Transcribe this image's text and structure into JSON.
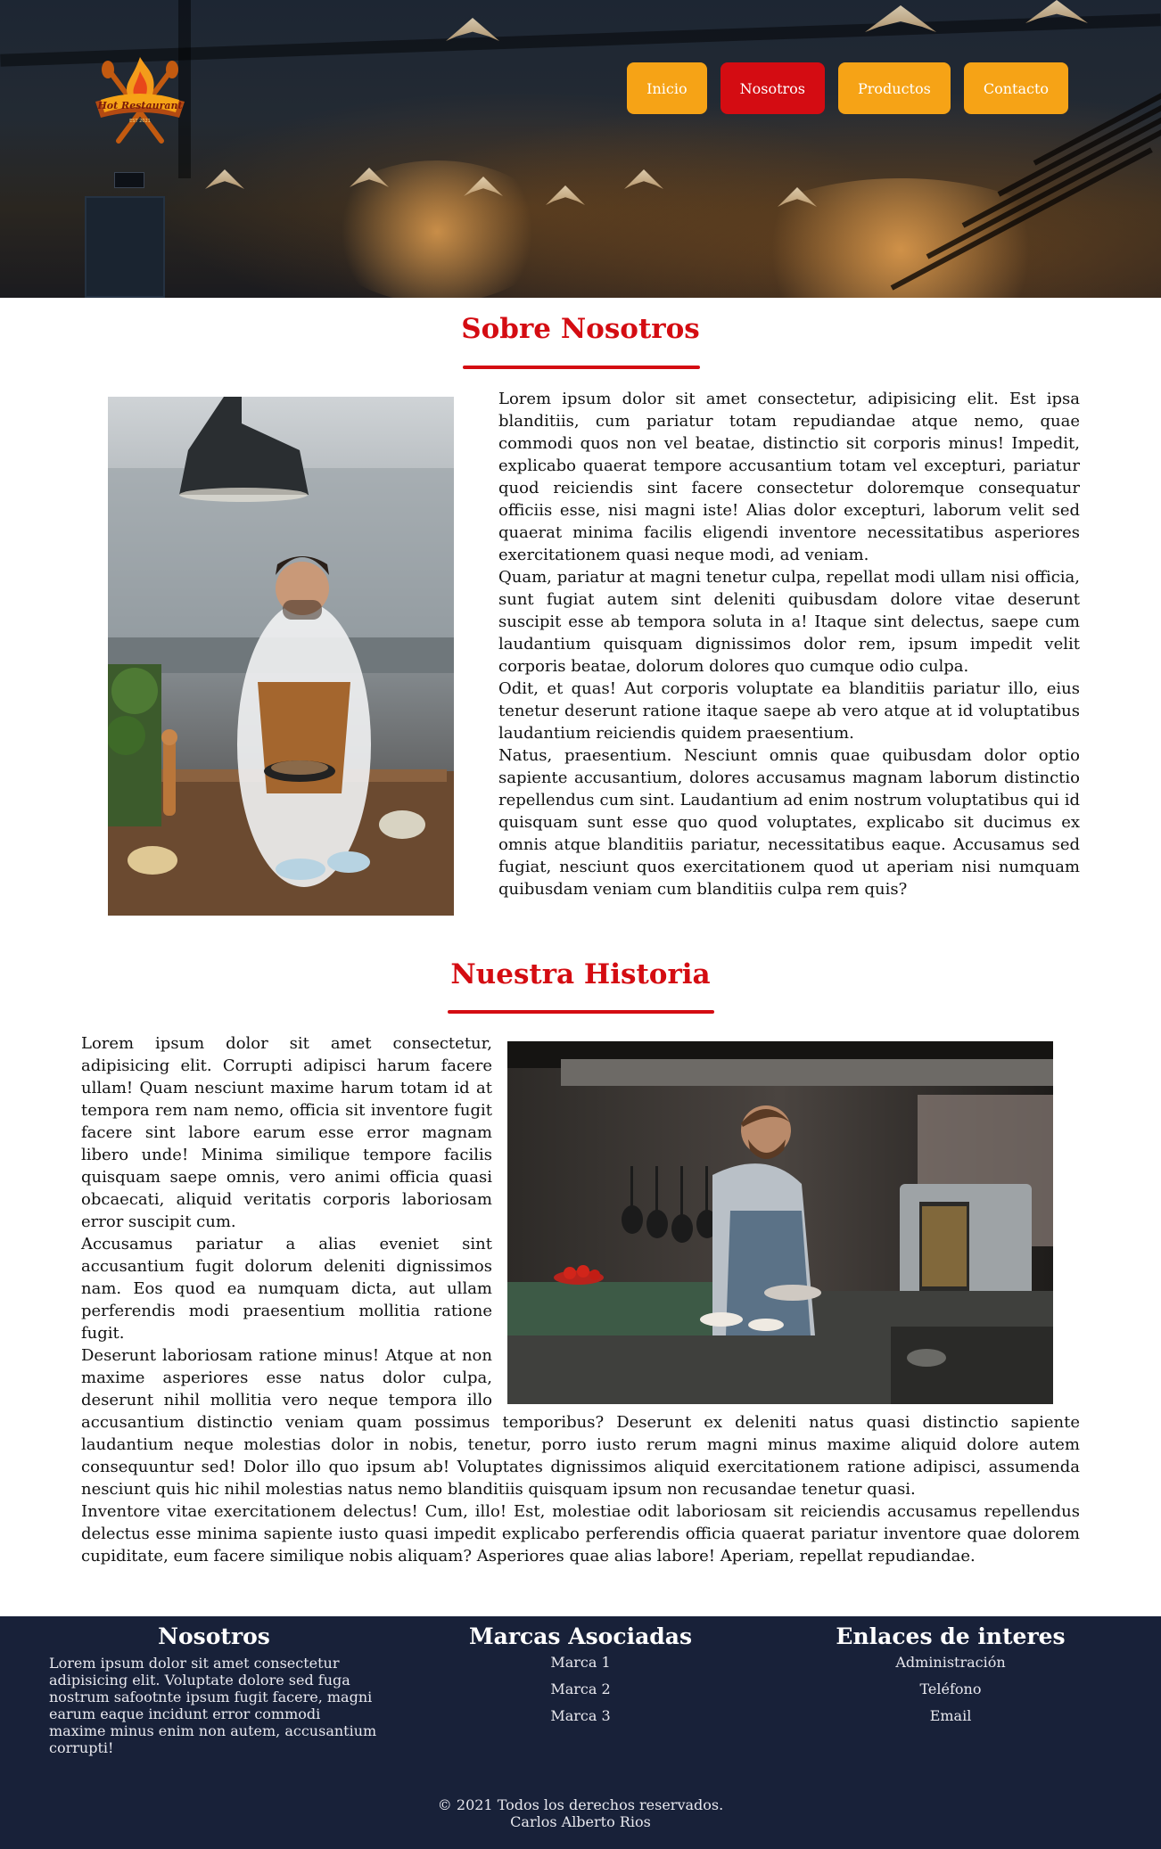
{
  "brand": {
    "logo_text": "Hot Restaurant",
    "logo_subtext": "EST 2021"
  },
  "nav": {
    "items": [
      {
        "label": "Inicio",
        "active": false
      },
      {
        "label": "Nosotros",
        "active": true
      },
      {
        "label": "Productos",
        "active": false
      },
      {
        "label": "Contacto",
        "active": false
      }
    ]
  },
  "about": {
    "title": "Sobre Nosotros",
    "paragraphs": [
      "Lorem ipsum dolor sit amet consectetur, adipisicing elit. Est ipsa blanditiis, cum pariatur totam repudiandae atque nemo, quae commodi quos non vel beatae, distinctio sit corporis minus! Impedit, explicabo quaerat tempore accusantium totam vel excepturi, pariatur quod reiciendis sint facere consectetur doloremque consequatur officiis esse, nisi magni iste! Alias dolor excepturi, laborum velit sed quaerat minima facilis eligendi inventore necessitatibus asperiores exercitationem quasi neque modi, ad veniam.",
      "Quam, pariatur at magni tenetur culpa, repellat modi ullam nisi officia, sunt fugiat autem sint deleniti quibusdam dolore vitae deserunt suscipit esse ab tempora soluta in a! Itaque sint delectus, saepe cum laudantium quisquam dignissimos dolor rem, ipsum impedit velit corporis beatae, dolorum dolores quo cumque odio culpa.",
      "Odit, et quas! Aut corporis voluptate ea blanditiis pariatur illo, eius tenetur deserunt ratione itaque saepe ab vero atque at id voluptatibus laudantium reiciendis quidem praesentium.",
      "Natus, praesentium. Nesciunt omnis quae quibusdam dolor optio sapiente accusantium, dolores accusamus magnam laborum distinctio repellendus cum sint. Laudantium ad enim nostrum voluptatibus qui id quisquam sunt esse quo quod voluptates, explicabo sit ducimus ex omnis atque blanditiis pariatur, necessitatibus eaque. Accusamus sed fugiat, nesciunt quos exercitationem quod ut aperiam nisi numquam quibusdam veniam cum blanditiis culpa rem quis?"
    ]
  },
  "history": {
    "title": "Nuestra Historia",
    "paragraphs": [
      "Lorem ipsum dolor sit amet consectetur, adipisicing elit. Corrupti adipisci harum facere ullam! Quam nesciunt maxime harum totam id at tempora rem nam nemo, officia sit inventore fugit facere sint labore earum esse error magnam libero unde! Minima similique tempore facilis quisquam saepe omnis, vero animi officia quasi obcaecati, aliquid veritatis corporis laboriosam error suscipit cum.",
      "Accusamus pariatur a alias eveniet sint accusantium fugit dolorum deleniti dignissimos nam. Eos quod ea numquam dicta, aut ullam perferendis modi praesentium mollitia ratione fugit.",
      "Deserunt laboriosam ratione minus! Atque at non maxime asperiores esse natus dolor culpa, deserunt nihil mollitia vero neque tempora illo accusantium distinctio veniam quam possimus temporibus? Deserunt ex deleniti natus quasi distinctio sapiente laudantium neque molestias dolor in nobis, tenetur, porro iusto rerum magni minus maxime aliquid dolore autem consequuntur sed! Dolor illo quo ipsum ab! Voluptates dignissimos aliquid exercitationem ratione adipisci, assumenda nesciunt quis hic nihil molestias natus nemo blanditiis quisquam ipsum non recusandae tenetur quasi.",
      "Inventore vitae exercitationem delectus! Cum, illo! Est, molestiae odit laboriosam sit reiciendis accusamus repellendus delectus esse minima sapiente iusto quasi impedit explicabo perferendis officia quaerat pariatur inventore quae dolorem cupiditate, eum facere similique nobis aliquam? Asperiores quae alias labore! Aperiam, repellat repudiandae."
    ]
  },
  "footer": {
    "about": {
      "title": "Nosotros",
      "text": "Lorem ipsum dolor sit amet consectetur adipisicing elit. Voluptate dolore sed fuga nostrum safootnte ipsum fugit facere, magni earum eaque incidunt error commodi maxime minus enim non autem, accusantium corrupti!"
    },
    "brands": {
      "title": "Marcas Asociadas",
      "items": [
        "Marca 1",
        "Marca 2",
        "Marca 3"
      ]
    },
    "links": {
      "title": "Enlaces de interes",
      "items": [
        "Administración",
        "Teléfono",
        "Email"
      ]
    },
    "copyright": "© 2021 Todos los derechos reservados.",
    "author": "Carlos Alberto Rios"
  },
  "colors": {
    "accent_red": "#d40c12",
    "nav_orange": "#f6a316",
    "footer_bg": "#182139"
  }
}
